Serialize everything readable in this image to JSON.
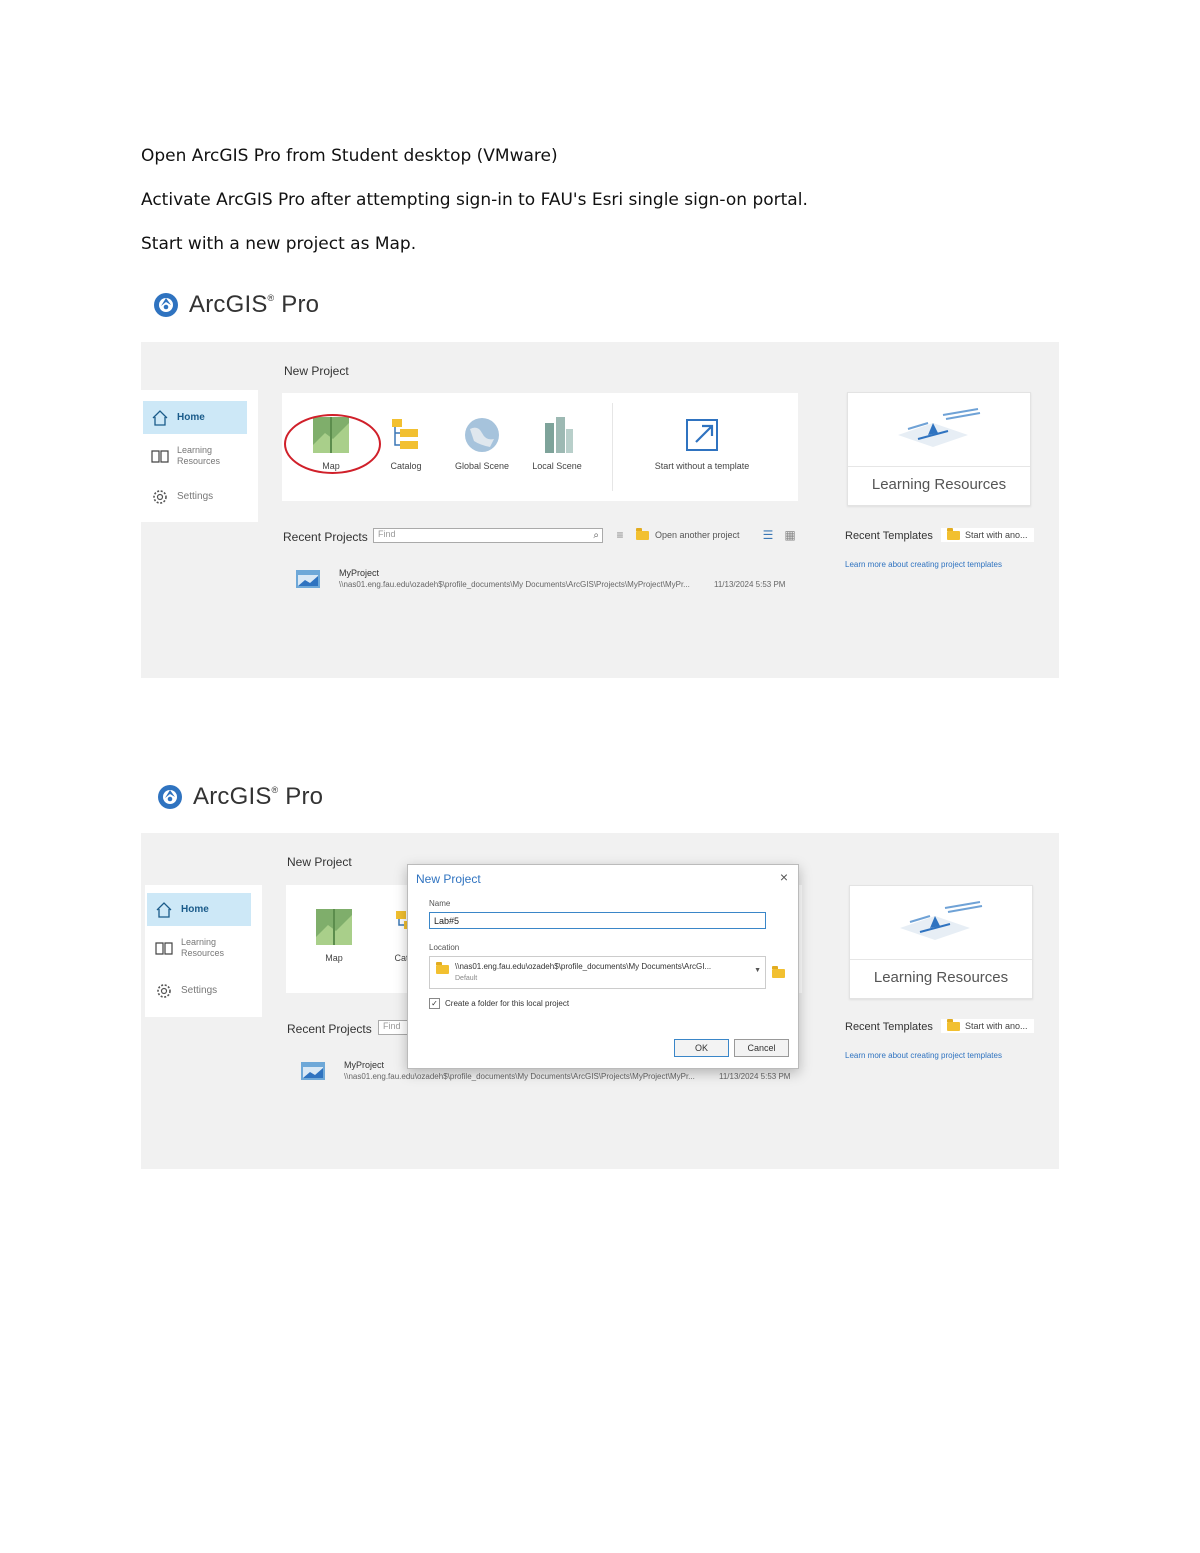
{
  "doc": {
    "line1": "Open ArcGIS Pro from Student desktop (VMware)",
    "line2": "Activate ArcGIS Pro after attempting sign-in to FAU's Esri single sign-on portal.",
    "line3": "Start with a new project as Map."
  },
  "brand": {
    "name": "ArcGIS",
    "reg": "®",
    "suffix": "Pro"
  },
  "sidebar": {
    "home": "Home",
    "learning_line1": "Learning",
    "learning_line2": "Resources",
    "settings": "Settings"
  },
  "new_project": {
    "title": "New Project",
    "tiles": {
      "map": "Map",
      "catalog": "Catalog",
      "global_scene": "Global Scene",
      "local_scene": "Local Scene",
      "start_without": "Start without a template"
    }
  },
  "learning_card": {
    "title": "Learning Resources"
  },
  "recent": {
    "label": "Recent Projects",
    "find_placeholder": "Find",
    "open_other": "Open another project",
    "project_name": "MyProject",
    "project_path": "\\\\nas01.eng.fau.edu\\ozadeh$\\profile_documents\\My Documents\\ArcGIS\\Projects\\MyProject\\MyPr...",
    "project_date": "11/13/2024 5:53 PM"
  },
  "templates": {
    "label": "Recent Templates",
    "item": "Start with ano...",
    "link": "Learn more about creating project templates"
  },
  "dialog": {
    "title": "New Project",
    "close": "×",
    "name_label": "Name",
    "name_value": "Lab#5",
    "location_label": "Location",
    "location_path": "\\\\nas01.eng.fau.edu\\ozadeh$\\profile_documents\\My Documents\\ArcGI...",
    "location_default": "Default",
    "checkbox_label": "Create a folder for this local project",
    "ok": "OK",
    "cancel": "Cancel"
  },
  "colors": {
    "accent": "#2f73c0",
    "annotation": "#d0202a",
    "panel_bg": "#f1f1f1",
    "nav_active": "#cde8f7"
  }
}
